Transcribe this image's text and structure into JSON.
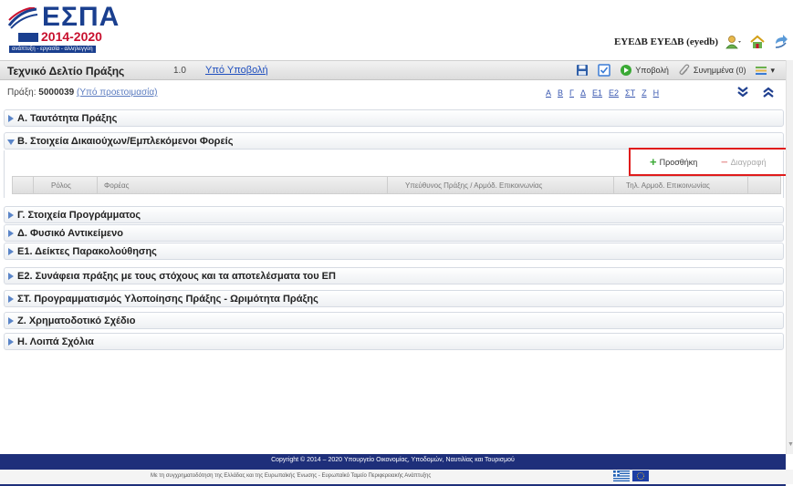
{
  "logo": {
    "name": "ΕΣΠΑ",
    "years": "2014-2020",
    "tagline": "ανάπτυξη - εργασία - αλληλεγγύη"
  },
  "user": {
    "name": "ΕΥΕΔΒ ΕΥΕΔΒ (eyedb)"
  },
  "document": {
    "title": "Τεχνικό Δελτίο Πράξης",
    "version": "1.0",
    "status": "Υπό Υποβολή",
    "praxi_label": "Πράξη:",
    "praxi_code": "5000039",
    "praxi_status": "(Υπό προετοιμασία)"
  },
  "toolbar": {
    "submit_label": "Υποβολή",
    "attachments_label": "Συνημμένα (0)"
  },
  "letters": [
    "Α",
    "Β",
    "Γ",
    "Δ",
    "Ε1",
    "Ε2",
    "ΣΤ",
    "Ζ",
    "Η"
  ],
  "sections": [
    {
      "label": "Α. Ταυτότητα Πράξης",
      "expanded": false
    },
    {
      "label": "Β. Στοιχεία Δικαιούχων/Εμπλεκόμενοι Φορείς",
      "expanded": true
    },
    {
      "label": "Γ. Στοιχεία Προγράμματος",
      "expanded": false
    },
    {
      "label": "Δ. Φυσικό Αντικείμενο",
      "expanded": false
    },
    {
      "label": "Ε1. Δείκτες Παρακολούθησης",
      "expanded": false
    },
    {
      "label": "Ε2. Συνάφεια πράξης με τους στόχους και τα αποτελέσματα του ΕΠ",
      "expanded": false
    },
    {
      "label": "ΣΤ. Προγραμματισμός Υλοποίησης Πράξης - Ωριμότητα Πράξης",
      "expanded": false
    },
    {
      "label": "Ζ. Χρηματοδοτικό Σχέδιο",
      "expanded": false
    },
    {
      "label": "Η. Λοιπά Σχόλια",
      "expanded": false
    }
  ],
  "section_b": {
    "add_label": "Προσθήκη",
    "delete_label": "Διαγραφή",
    "columns": [
      "Ρόλος",
      "Φορέας",
      "Υπεύθυνος Πράξης / Αρμόδ. Επικοινωνίας",
      "Τηλ. Αρμοδ. Επικοινωνίας"
    ]
  },
  "footer": {
    "copyright": "Copyright © 2014 – 2020 Υπουργείο Οικονομίας, Υποδομών, Ναυτιλίας και Τουρισμού",
    "cofund": "Με τη συγχρηματοδότηση της Ελλάδας και της Ευρωπαϊκής Ένωσης - Ευρωπαϊκό Ταμείο Περιφερειακής Ανάπτυξης"
  },
  "icons": {
    "user": "user-icon",
    "home": "home-icon",
    "logout": "logout-icon",
    "save": "save-icon",
    "check": "check-icon",
    "submit": "submit-icon",
    "attach": "paperclip-icon",
    "menu": "menu-icon",
    "expand_all": "expand-all-icon",
    "collapse_all": "collapse-all-icon"
  }
}
